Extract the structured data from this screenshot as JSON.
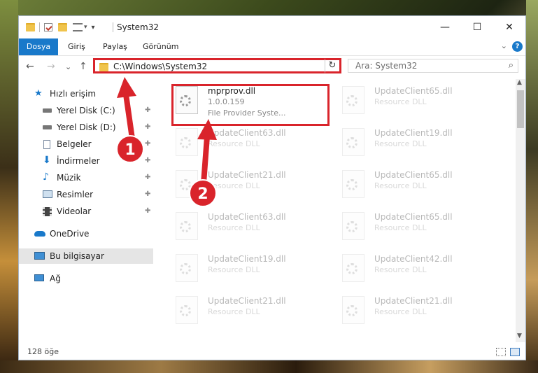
{
  "window": {
    "title": "System32",
    "minimize_glyph": "—",
    "maximize_glyph": "☐",
    "close_glyph": "✕"
  },
  "ribbon": {
    "tabs": [
      "Dosya",
      "Giriş",
      "Paylaş",
      "Görünüm"
    ],
    "help_glyph": "?",
    "collapse_glyph": "⌄"
  },
  "navigation": {
    "back_glyph": "←",
    "forward_glyph": "→",
    "recent_glyph": "⌄",
    "up_glyph": "↑",
    "address_path": "C:\\Windows\\System32",
    "address_dropdown_glyph": "⌄",
    "refresh_glyph": "↻",
    "search_placeholder": "Ara: System32",
    "search_glyph": "⌕"
  },
  "sidebar": {
    "items": [
      {
        "label": "Hızlı erişim",
        "icon": "star-icon",
        "pinned": false
      },
      {
        "label": "Yerel Disk (C:)",
        "icon": "drive-icon",
        "pinned": true
      },
      {
        "label": "Yerel Disk (D:)",
        "icon": "drive-icon",
        "pinned": true
      },
      {
        "label": "Belgeler",
        "icon": "document-icon",
        "pinned": true
      },
      {
        "label": "İndirmeler",
        "icon": "download-icon",
        "pinned": true
      },
      {
        "label": "Müzik",
        "icon": "music-icon",
        "pinned": true
      },
      {
        "label": "Resimler",
        "icon": "pictures-icon",
        "pinned": true
      },
      {
        "label": "Videolar",
        "icon": "video-icon",
        "pinned": true
      },
      {
        "label": "OneDrive",
        "icon": "cloud-icon",
        "pinned": false
      },
      {
        "label": "Bu bilgisayar",
        "icon": "computer-icon",
        "pinned": false,
        "selected": true
      },
      {
        "label": "Ağ",
        "icon": "network-icon",
        "pinned": false
      }
    ],
    "pin_glyph": "📌"
  },
  "files": {
    "left": [
      {
        "name": "mprprov.dll",
        "line1": "1.0.0.159",
        "line2": "File Provider Syste...",
        "highlighted": true
      },
      {
        "name": "UpdateClient63.dll",
        "line1": "Resource DLL"
      },
      {
        "name": "UpdateClient21.dll",
        "line1": "Resource DLL"
      },
      {
        "name": "UpdateClient63.dll",
        "line1": "Resource DLL"
      },
      {
        "name": "UpdateClient19.dll",
        "line1": "Resource DLL"
      },
      {
        "name": "UpdateClient21.dll",
        "line1": "Resource DLL"
      }
    ],
    "right": [
      {
        "name": "UpdateClient65.dll",
        "line1": "Resource DLL"
      },
      {
        "name": "UpdateClient19.dll",
        "line1": "Resource DLL"
      },
      {
        "name": "UpdateClient65.dll",
        "line1": "Resource DLL"
      },
      {
        "name": "UpdateClient65.dll",
        "line1": "Resource DLL"
      },
      {
        "name": "UpdateClient42.dll",
        "line1": "Resource DLL"
      },
      {
        "name": "UpdateClient21.dll",
        "line1": "Resource DLL"
      }
    ]
  },
  "status": {
    "item_count": "128 öğe"
  },
  "annotations": {
    "callout_1": "1",
    "callout_2": "2",
    "color": "#d9242b"
  },
  "colors": {
    "accent": "#1979ca",
    "highlight_red": "#d9242b",
    "selected_bg": "#e5e5e5"
  }
}
